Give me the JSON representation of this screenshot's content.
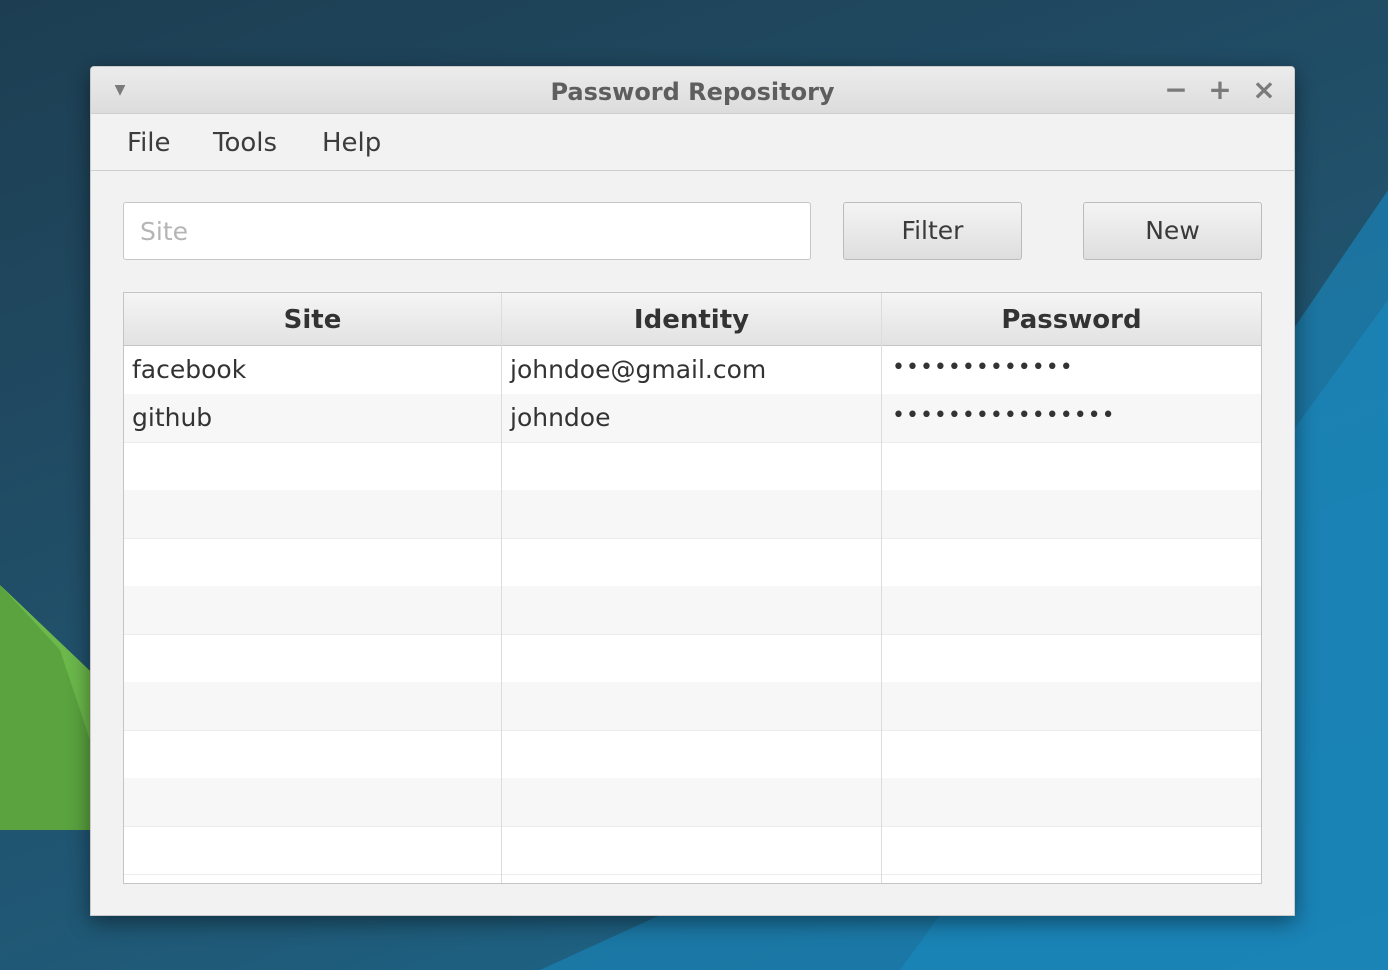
{
  "window": {
    "title": "Password Repository",
    "controls": {
      "menu_icon": "chevron-down-icon",
      "minimize_glyph": "−",
      "maximize_glyph": "+",
      "close_glyph": "×"
    }
  },
  "menubar": {
    "items": [
      "File",
      "Tools",
      "Help"
    ]
  },
  "toolbar": {
    "search_placeholder": "Site",
    "search_value": "",
    "filter_label": "Filter",
    "new_label": "New"
  },
  "table": {
    "columns": [
      "Site",
      "Identity",
      "Password"
    ],
    "rows": [
      {
        "site": "facebook",
        "identity": "johndoe@gmail.com",
        "password": "•••••••••••••"
      },
      {
        "site": "github",
        "identity": "johndoe",
        "password": "••••••••••••••••"
      }
    ],
    "visible_empty_rows": 9
  },
  "colors": {
    "desktop_dark": "#1d3e52",
    "desktop_blue": "#1c6d95",
    "desktop_green": "#5aa33f",
    "window_bg": "#f2f2f2",
    "alt_row": "#f7f7f7"
  }
}
